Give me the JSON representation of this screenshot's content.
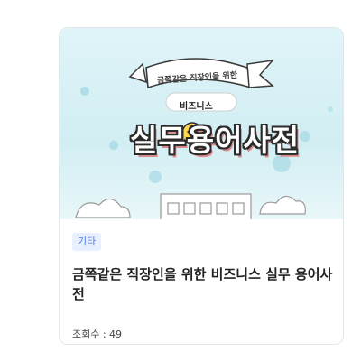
{
  "card": {
    "thumbnail": {
      "ribbon_text": "금쪽같은 직장인을 위한",
      "badge_text": "비즈니스",
      "big_title": "실무용어사전"
    },
    "category": "기타",
    "title": "금쪽같은 직장인을 위한 비즈니스 실무 용어사전",
    "views_label": "조회수 : 49"
  },
  "colors": {
    "thumb_bg": "#d6f0f4",
    "category_bg": "#e8f0ff",
    "category_text": "#4c7cf0",
    "title_outline": "#2b2b2b"
  }
}
